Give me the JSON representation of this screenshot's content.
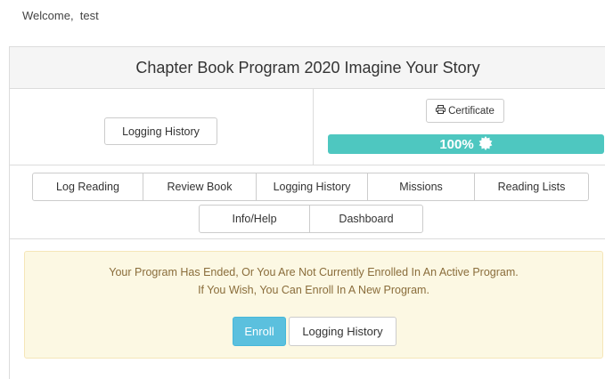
{
  "header": {
    "welcome_label": "Welcome,",
    "username": "test"
  },
  "program": {
    "title": "Chapter Book Program 2020 Imagine Your Story",
    "logging_history_label": "Logging History",
    "certificate_label": "Certificate",
    "progress_text": "100%",
    "progress_value": 1.0,
    "progress_color": "#4ec7c0"
  },
  "nav": {
    "items": [
      {
        "label": "Log Reading"
      },
      {
        "label": "Review Book"
      },
      {
        "label": "Logging History"
      },
      {
        "label": "Missions"
      },
      {
        "label": "Reading Lists"
      },
      {
        "label": "Info/Help"
      },
      {
        "label": "Dashboard"
      }
    ]
  },
  "notice": {
    "line1": "Your Program Has Ended, Or You Are Not Currently Enrolled In An Active Program.",
    "line2": "If You Wish, You Can Enroll In A New Program.",
    "enroll_label": "Enroll",
    "logging_history_label": "Logging History",
    "background_color": "#fcf8e3",
    "text_color": "#8a6d3b",
    "enroll_color": "#5bc0de"
  }
}
